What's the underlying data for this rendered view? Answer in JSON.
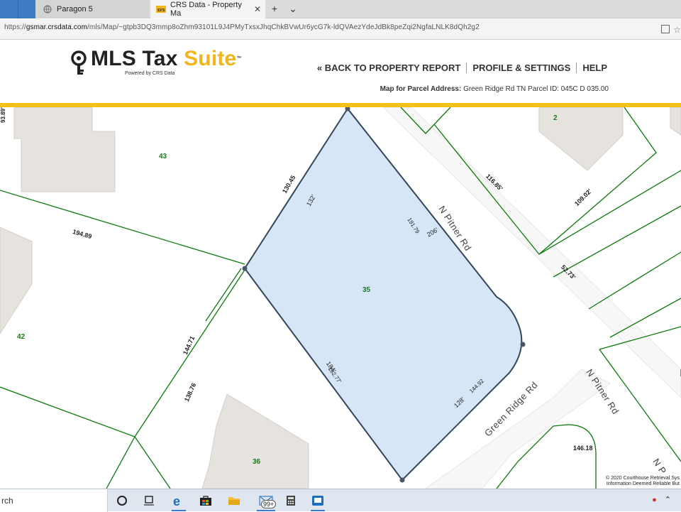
{
  "browser": {
    "tabs": [
      {
        "title": "Paragon 5",
        "active": false
      },
      {
        "title": "CRS Data - Property Ma",
        "active": true
      }
    ],
    "new_tab_symbol": "+",
    "tab_menu_symbol": "⌄",
    "url_prefix": "https://",
    "url_host": "gsmar.crsdata.com",
    "url_path": "/mls/Map/~gtpb3DQ3mmp8oZhm93101L9J4PMyTxsxJhqChkBVwUr6ycG7k-ldQVAezYdeJdBk8peZqi2NgfaLNLK8dQh2g2"
  },
  "header": {
    "logo_main": "MLS Tax ",
    "logo_accent": "Suite",
    "logo_tm": "™",
    "powered_by": "Powered by CRS Data",
    "nav": [
      {
        "label": "« BACK TO PROPERTY REPORT"
      },
      {
        "label": "PROFILE & SETTINGS"
      },
      {
        "label": "HELP"
      }
    ],
    "parcel_label": "Map for Parcel Address:",
    "parcel_value": "Green Ridge Rd TN Parcel ID: 045C D 035.00",
    "accent_color": "#f2c21b"
  },
  "map": {
    "lots": [
      "43",
      "2",
      "42",
      "35",
      "36"
    ],
    "roads": [
      "N Pitner Rd",
      "N Pitner Rd",
      "Green Ridge Rd",
      "N P"
    ],
    "dims": [
      "130.45",
      "132'",
      "191.79",
      "206'",
      "116.85'",
      "109.02'",
      "52.73'",
      "194.89",
      "144.71",
      "138.76",
      "184'",
      "182.77'",
      "128'",
      "144.92",
      "146.18",
      "93.89'"
    ],
    "copyright_line1": "© 2020 Courthouse Retrieval Sys",
    "copyright_line2": "Information Deemed Reliable But",
    "selected_fill": "#d6e6f7",
    "parcel_line_color": "#0a7a0a"
  },
  "taskbar": {
    "search_text": "rch",
    "badge": "99+"
  }
}
